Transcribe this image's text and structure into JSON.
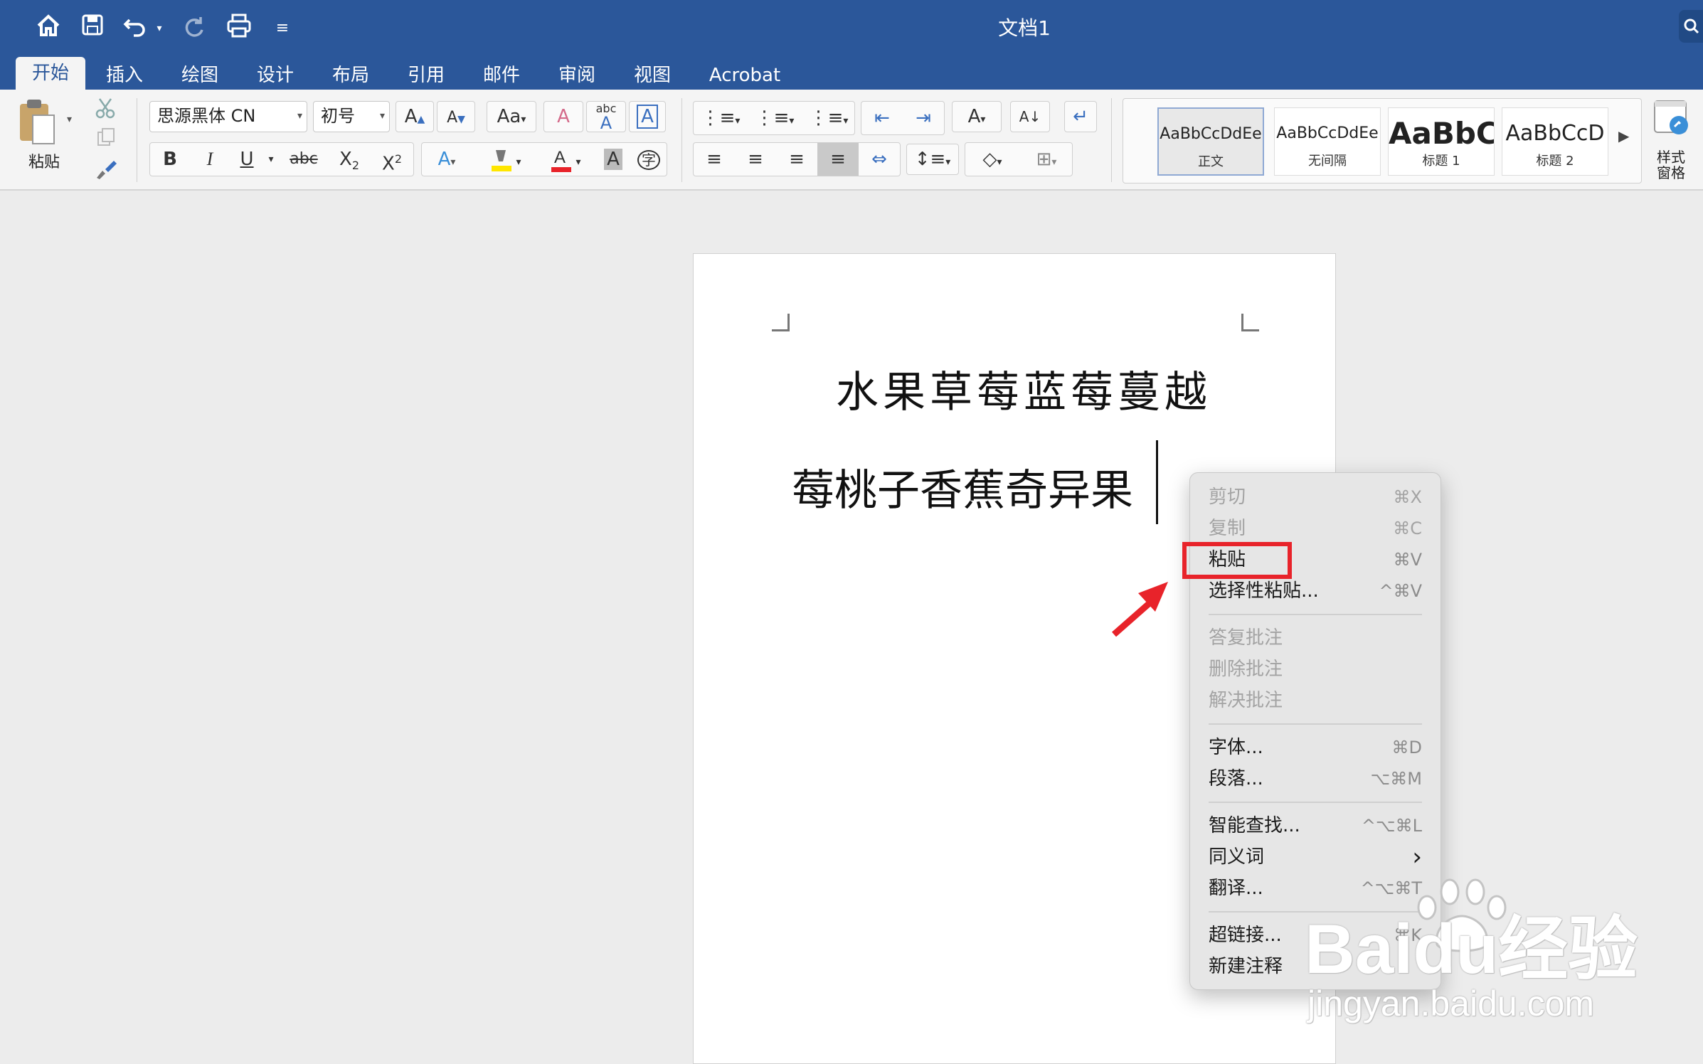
{
  "window": {
    "title": "文档1"
  },
  "tabs": [
    "开始",
    "插入",
    "绘图",
    "设计",
    "布局",
    "引用",
    "邮件",
    "审阅",
    "视图",
    "Acrobat"
  ],
  "ribbon": {
    "paste_label": "粘贴",
    "font_name": "思源黑体 CN",
    "font_size": "初号",
    "style_pane_label": "样式\n窗格",
    "styles": [
      {
        "sample": "AaBbCcDdEe",
        "name": "正文"
      },
      {
        "sample": "AaBbCcDdEe",
        "name": "无间隔"
      },
      {
        "sample": "AaBbC",
        "name": "标题 1"
      },
      {
        "sample": "AaBbCcD",
        "name": "标题 2"
      }
    ],
    "format_buttons": {
      "bold": "B",
      "italic": "I",
      "underline": "U",
      "strike": "abc"
    }
  },
  "document": {
    "line1": "水果草莓蓝莓蔓越",
    "line2": "莓桃子香蕉奇异果"
  },
  "context_menu": {
    "items": [
      {
        "label": "剪切",
        "shortcut": "⌘X",
        "enabled": false
      },
      {
        "label": "复制",
        "shortcut": "⌘C",
        "enabled": false
      },
      {
        "label": "粘贴",
        "shortcut": "⌘V",
        "enabled": true
      },
      {
        "label": "选择性粘贴...",
        "shortcut": "^⌘V",
        "enabled": true
      },
      {
        "label": "答复批注",
        "shortcut": "",
        "enabled": false
      },
      {
        "label": "删除批注",
        "shortcut": "",
        "enabled": false
      },
      {
        "label": "解决批注",
        "shortcut": "",
        "enabled": false
      },
      {
        "label": "字体...",
        "shortcut": "⌘D",
        "enabled": true
      },
      {
        "label": "段落...",
        "shortcut": "⌥⌘M",
        "enabled": true
      },
      {
        "label": "智能查找...",
        "shortcut": "^⌥⌘L",
        "enabled": true
      },
      {
        "label": "同义词",
        "shortcut": "›",
        "enabled": true
      },
      {
        "label": "翻译...",
        "shortcut": "^⌥⌘T",
        "enabled": true
      },
      {
        "label": "超链接...",
        "shortcut": "⌘K",
        "enabled": true
      },
      {
        "label": "新建注释",
        "shortcut": "",
        "enabled": true
      }
    ]
  },
  "watermark": {
    "brand": "Baidu经验",
    "url": "jingyan.baidu.com"
  },
  "colors": {
    "title_bar": "#2b579a",
    "highlight": "#e8232a",
    "font_color": "#e8232a",
    "highlighter": "#ffe600"
  }
}
